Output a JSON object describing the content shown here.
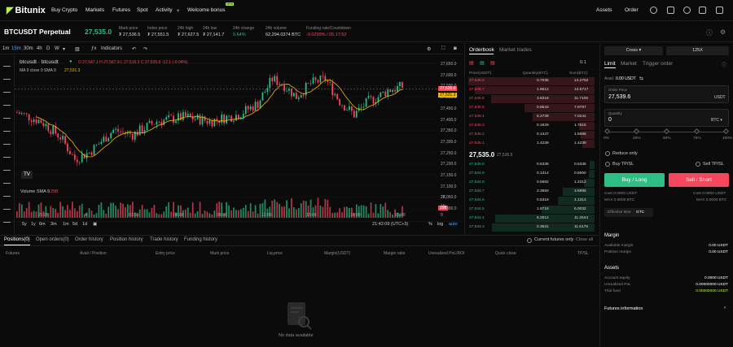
{
  "nav": {
    "logo": "Bitunix",
    "items": [
      "Buy Crypto",
      "Markets",
      "Futures",
      "Spot",
      "Activity",
      "Welcome bonus"
    ],
    "badge": "NEW",
    "right": [
      "Assets",
      "Order"
    ]
  },
  "ticker": {
    "symbol": "BTCUSDT Perpetual",
    "last": "27,535.0",
    "stats": [
      {
        "label": "Mark price",
        "value": "₮ 27,536.5"
      },
      {
        "label": "Index price",
        "value": "₮ 27,551.5"
      },
      {
        "label": "24h high",
        "value": "₮ 27,627.5"
      },
      {
        "label": "24h low",
        "value": "₮ 27,141.7"
      },
      {
        "label": "24h change",
        "value": "0.64%"
      },
      {
        "label": "24h volume",
        "value": "62,294.0374 BTC"
      },
      {
        "label": "Funding rate/Countdown",
        "value": "-0.0299% / 05:17:52"
      }
    ]
  },
  "chart": {
    "intervals": [
      "1m",
      "15m",
      "30m",
      "4h",
      "D",
      "W"
    ],
    "indicators_label": "Indicators",
    "title": "btcusdt · btcusdt",
    "ohlc": "O 27,547.1  H 27,567.9  L 27,515.3  C 27,535.0 -12.1 (-0.04%)",
    "ma": "MA 9 close 0 SMA 9",
    "ma_value": "27,531.3",
    "last_label": "27,535.0",
    "ma_label": "27,531.3",
    "prices": [
      "27,650.0",
      "27,600.0",
      "27,550.0",
      "27,500.0",
      "27,450.0",
      "27,400.0",
      "27,350.0",
      "27,300.0",
      "27,250.0",
      "27,200.0",
      "27,150.0",
      "27,100.0",
      "27,050.0",
      "27,000.0"
    ],
    "times": [
      "21:00",
      "4",
      "03:00",
      "06:00",
      "09:00",
      "12:00",
      "15:00",
      "18:00",
      "21:00"
    ],
    "volume_label": "Volume SMA 9",
    "volume_value": "298",
    "vol_scale": [
      "2K",
      "1K",
      "0"
    ],
    "vol_last": "298",
    "ranges": [
      "5y",
      "1y",
      "6m",
      "3m",
      "1m",
      "5d",
      "1d"
    ],
    "clock": "21:42:09 (UTC+3)",
    "pct": "%",
    "log": "log",
    "auto": "auto"
  },
  "tabs": [
    "Positions(0)",
    "Open orders(0)",
    "Order history",
    "Position history",
    "Trade history",
    "Funding history"
  ],
  "current_only": "Current futures only",
  "close_all": "Close all",
  "columns": [
    "Futures",
    "Avail / Position",
    "Entry price",
    "Mark price",
    "Liq.price",
    "Margin(USDT)",
    "Margin ratio",
    "Unrealized PnL/ROI",
    "Quick close",
    "TP/SL"
  ],
  "no_data": "No data available",
  "orderbook": {
    "tabs": [
      "Orderbook",
      "Market trades"
    ],
    "precision": "0.1",
    "headers": [
      "Price(USDT)",
      "Quantity(BTC)",
      "Sum(BTC)"
    ],
    "asks": [
      [
        "27,535.8",
        "0.7035",
        "14.2752"
      ],
      [
        "27,535.7",
        "1.8612",
        "13.5717"
      ],
      [
        "27,535.6",
        "3.8318",
        "11.7105"
      ],
      [
        "27,535.5",
        "0.8543",
        "7.8787"
      ],
      [
        "27,535.4",
        "5.2739",
        "7.0244"
      ],
      [
        "27,535.3",
        "0.1829",
        "1.7515"
      ],
      [
        "27,535.2",
        "0.1447",
        "1.5686"
      ],
      [
        "27,535.1",
        "1.4239",
        "1.4239"
      ]
    ],
    "mid": "27,535.0",
    "mid_mark": "27,536.5",
    "bids": [
      [
        "27,535.0",
        "0.5336",
        "0.5336"
      ],
      [
        "27,534.9",
        "0.1314",
        "0.6650"
      ],
      [
        "27,534.8",
        "0.5662",
        "1.2312"
      ],
      [
        "27,534.7",
        "2.3683",
        "3.5995"
      ],
      [
        "27,534.6",
        "0.5319",
        "4.1314"
      ],
      [
        "27,534.5",
        "1.8718",
        "6.0032"
      ],
      [
        "27,534.4",
        "5.2512",
        "11.2544"
      ],
      [
        "27,534.3",
        "0.3631",
        "11.6175"
      ]
    ]
  },
  "order": {
    "margin_mode": "Cross",
    "leverage": "125X",
    "types": [
      "Limit",
      "Market",
      "Trigger order"
    ],
    "avail_label": "Avail.",
    "avail": "0.00 USDT",
    "price_placeholder": "Order Price",
    "price": "27,539.6",
    "price_unit": "USDT",
    "qty_placeholder": "Quantity",
    "qty": "0",
    "qty_unit": "BTC",
    "slider": [
      "0%",
      "25%",
      "50%",
      "75%",
      "100%"
    ],
    "reduce_only": "Reduce only",
    "buy_tpsl": "Buy TP/SL",
    "sell_tpsl": "Sell TP/SL",
    "buy_btn": "Buy / Long",
    "sell_btn": "Sell / Short",
    "cost_l": "Cost 0.0000 USDT",
    "max_l": "MAX 0.0000 BTC",
    "cost_r": "Cost 0.0000 USDT",
    "max_r": "MAX 0.0000 BTC",
    "eff_label": "Effective time",
    "eff": "GTC"
  },
  "margin": {
    "title": "Margin",
    "rows": [
      [
        "Available margin",
        "0.00 USDT"
      ],
      [
        "Position margin",
        "0.00 USDT"
      ]
    ]
  },
  "assets": {
    "title": "Assets",
    "rows": [
      [
        "Account equity",
        "0.0000 USDT"
      ],
      [
        "Unrealized PnL",
        "0.00000000 USDT"
      ],
      [
        "Trial fund",
        "0.00000000 USDT"
      ]
    ]
  },
  "futures_info": "Futures information",
  "colors": {
    "up": "#2ebd85",
    "down": "#f6465d",
    "accent": "#b7f34a"
  }
}
